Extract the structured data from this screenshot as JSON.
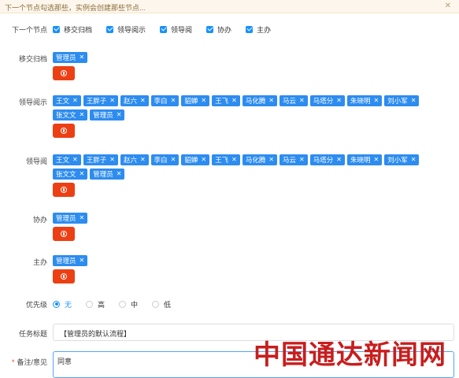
{
  "notice": {
    "text": "下一个节点勾选那些，实例会创建那些节点..."
  },
  "next_nodes": {
    "label": "下一个节点",
    "options": [
      "移交归档",
      "领导阅示",
      "领导阅",
      "协办",
      "主办"
    ]
  },
  "sections": {
    "transfer": {
      "label": "移交归档",
      "tags": [
        "管理员"
      ]
    },
    "leader_review": {
      "label": "领导阅示",
      "tags": [
        "王文",
        "王胖子",
        "赵六",
        "李白",
        "貂蝉",
        "王飞",
        "马化腾",
        "马云",
        "马塔分",
        "朱晓明",
        "刘小军",
        "张文文",
        "管理员"
      ]
    },
    "leader_read": {
      "label": "领导阅",
      "tags": [
        "王文",
        "王胖子",
        "赵六",
        "李白",
        "貂蝉",
        "王飞",
        "马化腾",
        "马云",
        "马塔分",
        "朱晓明",
        "刘小军",
        "张文文",
        "管理员"
      ]
    },
    "assist": {
      "label": "协办",
      "tags": [
        "管理员"
      ]
    },
    "host": {
      "label": "主办",
      "tags": [
        "管理员"
      ]
    }
  },
  "priority": {
    "label": "优先级",
    "options": [
      "无",
      "高",
      "中",
      "低"
    ],
    "selected": "无"
  },
  "task_title": {
    "label": "任务标题",
    "value": "【管理员的默认流程】"
  },
  "remark": {
    "label": "备注/意见",
    "required_mark": "*",
    "value": "同意"
  },
  "watermark": {
    "text": "中国通达新闻网"
  },
  "colors": {
    "tag": "#2d8cf0",
    "add_button": "#ed3f14",
    "checkbox": "#1890ff",
    "notice_bg": "#fdf6ec"
  }
}
